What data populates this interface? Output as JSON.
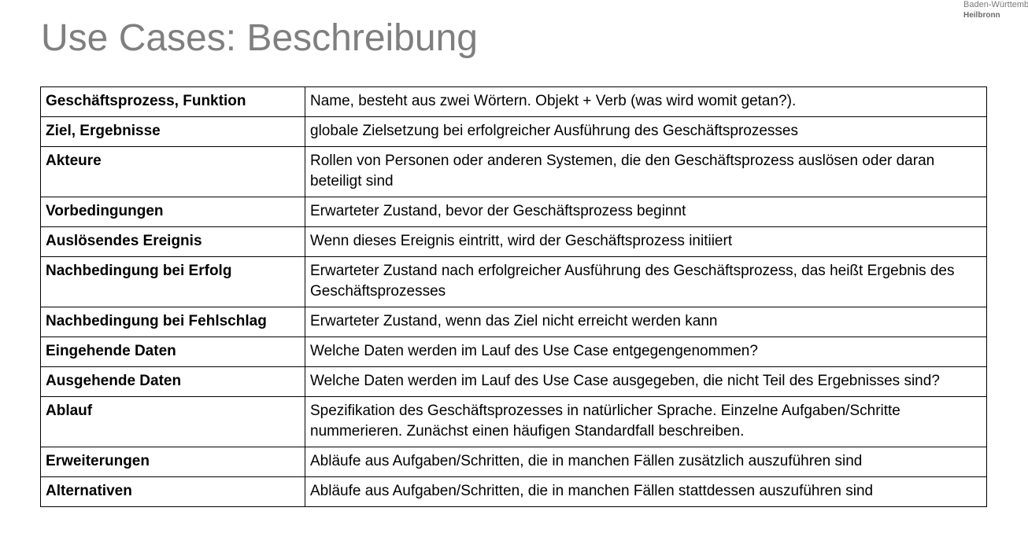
{
  "header": {
    "title": "Use Cases: Beschreibung",
    "logo_line1": "Baden-Württemb",
    "logo_line2": "Heilbronn"
  },
  "table": {
    "rows": [
      {
        "key": "Geschäftsprozess, Funktion",
        "value": "Name, besteht aus zwei Wörtern. Objekt + Verb (was wird womit getan?)."
      },
      {
        "key": "Ziel, Ergebnisse",
        "value": "globale Zielsetzung bei erfolgreicher Ausführung des Geschäftsprozesses"
      },
      {
        "key": "Akteure",
        "value": "Rollen von Personen oder anderen Systemen, die den Geschäftsprozess auslösen oder daran beteiligt sind"
      },
      {
        "key": "Vorbedingungen",
        "value": "Erwarteter Zustand, bevor der Geschäftsprozess beginnt"
      },
      {
        "key": "Auslösendes Ereignis",
        "value": "Wenn dieses Ereignis eintritt, wird der Geschäftsprozess initiiert"
      },
      {
        "key": "Nachbedingung bei Erfolg",
        "value": "Erwarteter Zustand nach erfolgreicher Ausführung des Geschäftsprozess, das heißt Ergebnis des Geschäftsprozesses"
      },
      {
        "key": "Nachbedingung bei Fehlschlag",
        "value": "Erwarteter Zustand, wenn das Ziel nicht erreicht werden kann"
      },
      {
        "key": "Eingehende Daten",
        "value": "Welche Daten werden im Lauf des Use Case entgegengenommen?"
      },
      {
        "key": "Ausgehende Daten",
        "value": "Welche Daten werden im Lauf des Use Case ausgegeben, die nicht Teil des Ergebnisses sind?"
      },
      {
        "key": "Ablauf",
        "value": "Spezifikation des Geschäftsprozesses in natürlicher Sprache. Einzelne Aufgaben/Schritte nummerieren. Zunächst einen häufigen Standardfall beschreiben."
      },
      {
        "key": "Erweiterungen",
        "value": "Abläufe aus Aufgaben/Schritten, die in manchen Fällen zusätzlich auszuführen sind"
      },
      {
        "key": "Alternativen",
        "value": "Abläufe aus Aufgaben/Schritten, die in manchen Fällen stattdessen auszuführen sind"
      }
    ]
  }
}
